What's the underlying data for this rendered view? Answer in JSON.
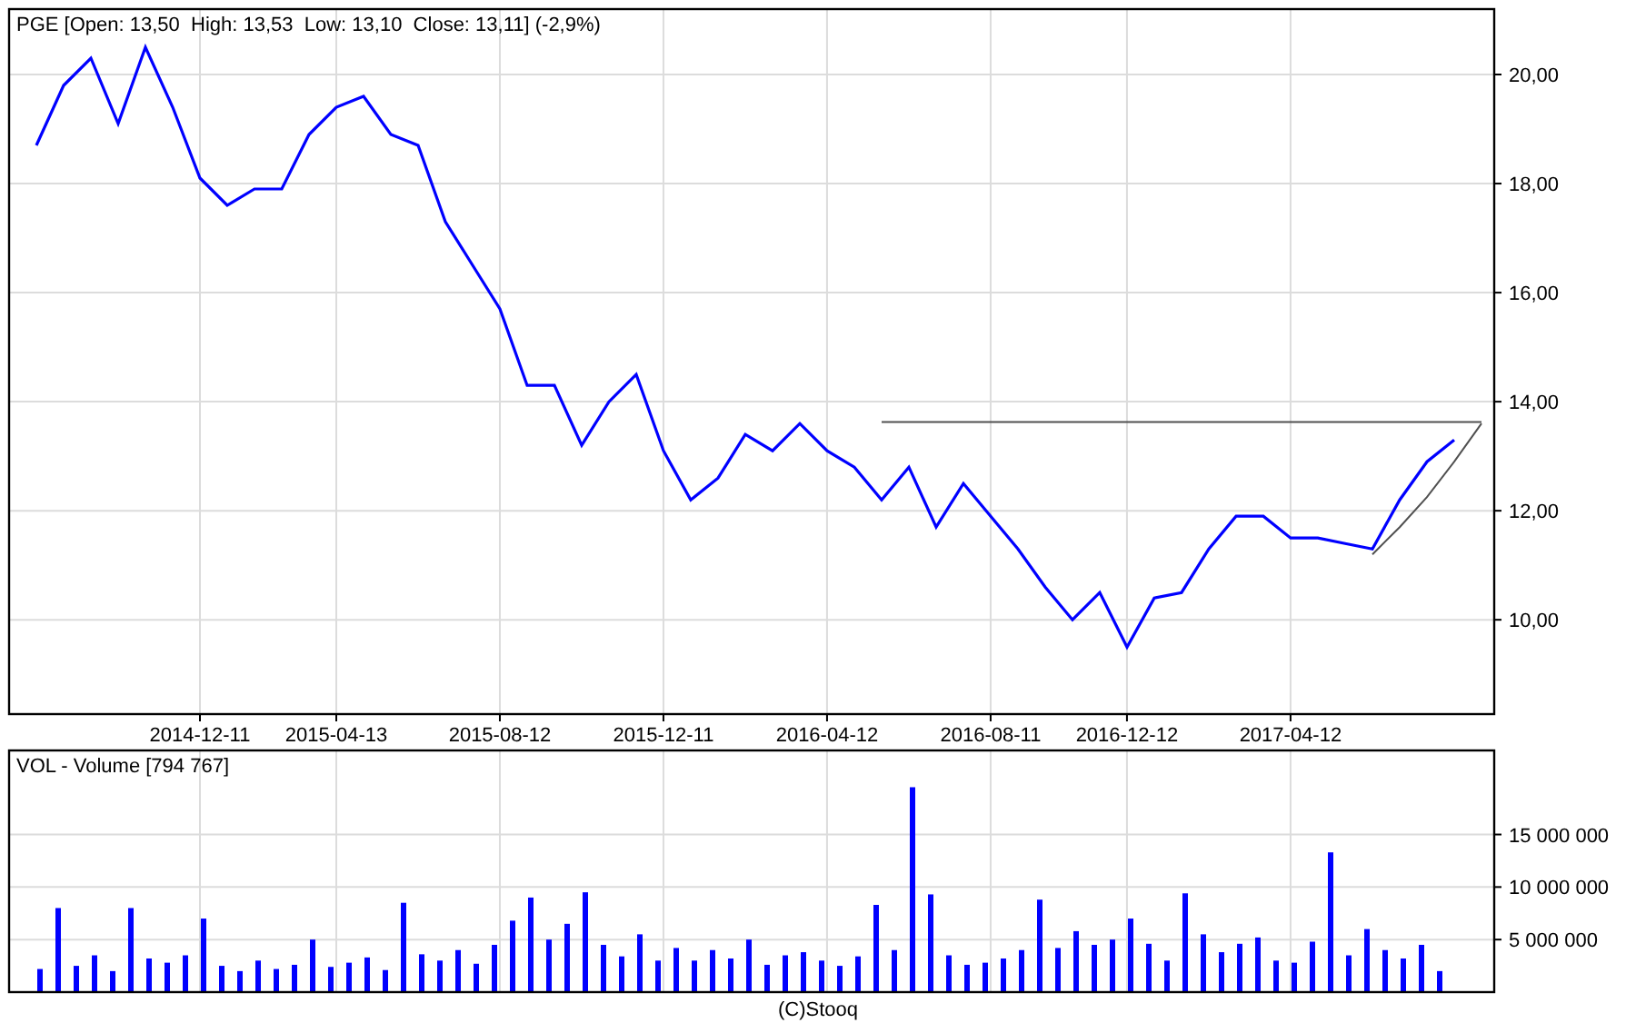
{
  "price_panel": {
    "title": "PGE [Open: 13,50  High: 13,53  Low: 13,10  Close: 13,11] (-2,9%)",
    "chart_data": {
      "type": "line",
      "grid": true,
      "categories": [
        null,
        null,
        null,
        null,
        null,
        null,
        "2014-12-11",
        null,
        null,
        null,
        null,
        "2015-04-13",
        null,
        null,
        null,
        null,
        null,
        "2015-08-12",
        null,
        null,
        null,
        null,
        null,
        "2015-12-11",
        null,
        null,
        null,
        null,
        null,
        "2016-04-12",
        null,
        null,
        null,
        null,
        null,
        "2016-08-11",
        null,
        null,
        null,
        null,
        "2016-12-12",
        null,
        null,
        null,
        null,
        null,
        "2017-04-12",
        null,
        null,
        null,
        null,
        null,
        null,
        null
      ],
      "series": [
        {
          "color": "#0000ff",
          "values": [
            18.7,
            19.8,
            20.3,
            19.1,
            20.5,
            19.4,
            18.1,
            17.6,
            17.9,
            17.9,
            18.9,
            19.4,
            19.6,
            18.9,
            18.7,
            17.3,
            16.5,
            15.7,
            14.3,
            14.3,
            13.2,
            14.0,
            14.5,
            13.1,
            12.2,
            12.6,
            13.4,
            13.1,
            13.6,
            13.1,
            12.8,
            12.2,
            12.8,
            11.7,
            12.5,
            11.9,
            11.3,
            10.6,
            10.0,
            10.5,
            9.5,
            10.4,
            10.5,
            11.3,
            11.9,
            11.9,
            11.5,
            11.5,
            11.4,
            11.3,
            12.2,
            12.9,
            13.3,
            null
          ]
        },
        {
          "color": "#505050",
          "values": [
            null,
            null,
            null,
            null,
            null,
            null,
            null,
            null,
            null,
            null,
            null,
            null,
            null,
            null,
            null,
            null,
            null,
            null,
            null,
            null,
            null,
            null,
            null,
            null,
            null,
            null,
            null,
            null,
            null,
            null,
            null,
            13.63,
            13.63,
            13.63,
            13.63,
            13.63,
            13.63,
            13.63,
            13.63,
            13.63,
            13.63,
            13.63,
            13.63,
            13.63,
            13.63,
            13.63,
            13.63,
            13.63,
            13.63,
            13.63,
            13.63,
            13.63,
            13.63,
            13.63
          ]
        },
        {
          "color": "#505050",
          "values": [
            null,
            null,
            null,
            null,
            null,
            null,
            null,
            null,
            null,
            null,
            null,
            null,
            null,
            null,
            null,
            null,
            null,
            null,
            null,
            null,
            null,
            null,
            null,
            null,
            null,
            null,
            null,
            null,
            null,
            null,
            null,
            null,
            null,
            null,
            null,
            null,
            null,
            null,
            null,
            null,
            null,
            null,
            null,
            null,
            null,
            null,
            null,
            null,
            null,
            11.2,
            11.7,
            12.25,
            12.9,
            13.6
          ]
        }
      ],
      "ylim": [
        8.27,
        21.2
      ],
      "yticks": [
        {
          "value": 10,
          "label": "10,00"
        },
        {
          "value": 12,
          "label": "12,00"
        },
        {
          "value": 14,
          "label": "14,00"
        },
        {
          "value": 16,
          "label": "16,00"
        },
        {
          "value": 18,
          "label": "18,00"
        },
        {
          "value": 20,
          "label": "20,00"
        }
      ]
    }
  },
  "volume_panel": {
    "title": "VOL - Volume [794 767]",
    "chart_data": {
      "type": "bar",
      "grid": true,
      "categories": [
        null,
        null,
        null,
        null,
        null,
        null,
        null,
        null,
        null,
        null,
        null,
        null,
        null,
        null,
        null,
        null,
        null,
        null,
        null,
        null,
        null,
        null,
        null,
        null,
        null,
        null,
        null,
        null,
        null,
        null,
        null,
        null,
        null,
        null,
        null,
        null,
        null,
        null,
        null,
        null,
        null,
        null,
        null,
        null,
        null,
        null,
        null,
        null,
        null,
        null,
        null,
        null,
        null,
        null,
        null,
        null,
        null,
        null,
        null,
        null,
        null,
        null,
        null,
        null,
        null,
        null,
        null,
        null,
        null,
        null,
        null,
        null,
        null,
        null,
        null,
        null,
        null,
        null
      ],
      "series": [
        {
          "color": "#0000ff",
          "values": [
            2200000,
            8000000,
            2500000,
            3500000,
            2000000,
            8000000,
            3200000,
            2800000,
            3500000,
            7000000,
            2500000,
            2000000,
            3000000,
            2200000,
            2600000,
            5000000,
            2400000,
            2800000,
            3300000,
            2100000,
            8500000,
            3600000,
            3000000,
            4000000,
            2700000,
            4500000,
            6800000,
            9000000,
            5000000,
            6500000,
            9500000,
            4500000,
            3400000,
            5500000,
            3000000,
            4200000,
            3000000,
            4000000,
            3200000,
            5000000,
            2600000,
            3500000,
            3800000,
            3000000,
            2500000,
            3400000,
            8300000,
            4000000,
            19500000,
            9300000,
            3500000,
            2600000,
            2800000,
            3200000,
            4000000,
            8800000,
            4200000,
            5800000,
            4500000,
            5000000,
            7000000,
            4600000,
            3000000,
            9400000,
            5500000,
            3800000,
            4600000,
            5200000,
            3000000,
            2800000,
            4800000,
            13300000,
            3500000,
            6000000,
            4000000,
            3200000,
            4500000,
            2000000
          ]
        }
      ],
      "ylim": [
        0,
        23000000
      ],
      "yticks": [
        {
          "value": 5000000,
          "label": "5 000 000"
        },
        {
          "value": 10000000,
          "label": "10 000 000"
        },
        {
          "value": 15000000,
          "label": "15 000 000"
        }
      ]
    }
  },
  "footer": "(C)Stooq"
}
